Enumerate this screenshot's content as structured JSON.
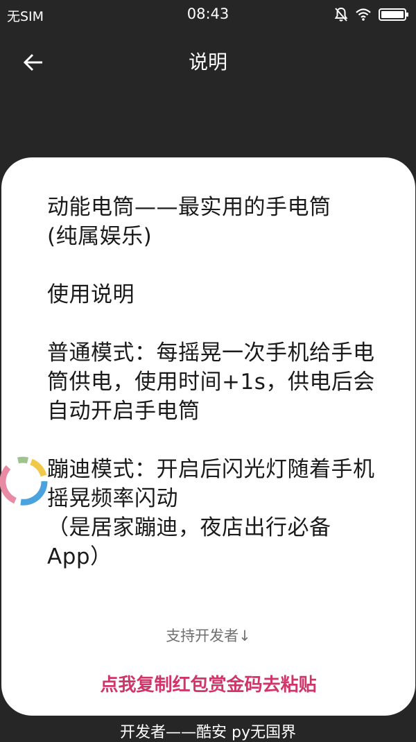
{
  "status_bar": {
    "carrier": "无SIM",
    "time": "08:43",
    "icons": [
      "mute-bell-icon",
      "wifi-icon",
      "battery-icon"
    ]
  },
  "toolbar": {
    "back_icon": "arrow-left-icon",
    "title": "说明"
  },
  "card": {
    "description": "动能电筒——最实用的手电筒\n(纯属娱乐)\n\n使用说明\n\n普通模式：每摇晃一次手机给手电筒供电，使用时间+1s，供电后会自动开启手电筒\n\n蹦迪模式：开启后闪光灯随着手机摇晃频率闪动\n（是居家蹦迪，夜店出行必备App）",
    "support_label": "支持开发者↓",
    "copy_link": "点我复制红包赏金码去粘贴"
  },
  "footer": {
    "credit": "开发者——酷安 py无国界"
  },
  "colors": {
    "background": "#262626",
    "card": "#ffffff",
    "link": "#d0356a",
    "spinner": [
      "#9dc38f",
      "#f2c84b",
      "#4aa3df",
      "#e98aa5"
    ]
  }
}
